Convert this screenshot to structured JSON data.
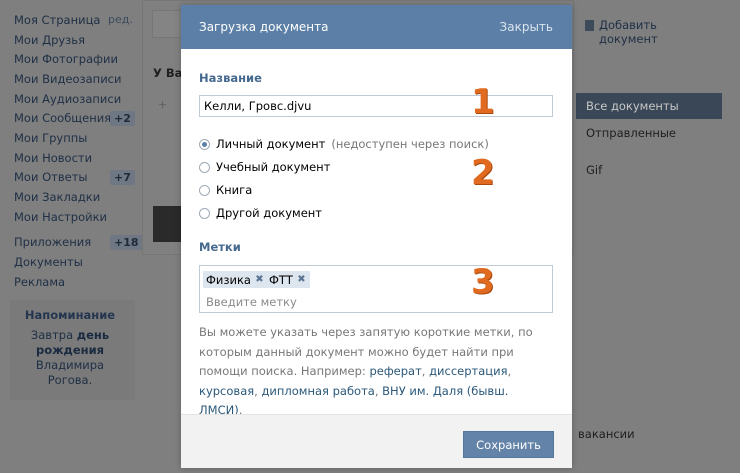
{
  "background": {
    "nav": [
      {
        "label": "Моя Страница",
        "extra": "ред."
      },
      {
        "label": "Мои Друзья"
      },
      {
        "label": "Мои Фотографии"
      },
      {
        "label": "Мои Видеозаписи"
      },
      {
        "label": "Мои Аудиозаписи"
      },
      {
        "label": "Мои Сообщения",
        "badge": "+2"
      },
      {
        "label": "Мои Группы"
      },
      {
        "label": "Мои Новости"
      },
      {
        "label": "Мои Ответы",
        "badge": "+7"
      },
      {
        "label": "Мои Закладки"
      },
      {
        "label": "Мои Настройки"
      },
      {
        "label": "Приложения",
        "badge": "+18"
      },
      {
        "label": "Документы"
      },
      {
        "label": "Реклама"
      }
    ],
    "reminder": {
      "title": "Напоминание",
      "line1_prefix": "Завтра ",
      "line1_bold": "день",
      "line2_bold": "рождения",
      "line3": "Владимира",
      "line4": "Рогова."
    },
    "center_heading": "У Ва",
    "center_plus": "+",
    "add_document": {
      "line1": "Добавить",
      "line2": "документ"
    },
    "right_tabs": [
      "Все документы",
      "Отправленные",
      "Gif"
    ],
    "vacancies": "вакансии"
  },
  "modal": {
    "title": "Загрузка документа",
    "close_label": "Закрыть",
    "name_label": "Название",
    "name_value": "Келли, Гровс.djvu",
    "radios": [
      {
        "label": "Личный документ",
        "note": "(недоступен через поиск)",
        "checked": true
      },
      {
        "label": "Учебный документ",
        "note": "",
        "checked": false
      },
      {
        "label": "Книга",
        "note": "",
        "checked": false
      },
      {
        "label": "Другой документ",
        "note": "",
        "checked": false
      }
    ],
    "tags_label": "Метки",
    "tags": [
      "Физика",
      "ФТТ"
    ],
    "tags_placeholder": "Введите метку",
    "hint": {
      "text_before": "Вы можете указать через запятую короткие метки, по которым данный документ можно будет найти при помощи поиска. Например: ",
      "examples": [
        "реферат",
        "диссертация",
        "курсовая",
        "дипломная работа",
        "ВНУ им. Даля (бывш. ЛМСИ)"
      ],
      "text_after": "."
    },
    "save_label": "Сохранить"
  },
  "annotations": [
    "1",
    "2",
    "3"
  ],
  "colors": {
    "header_bg": "#5b7fa6",
    "accent_text": "#45688e",
    "button_bg": "#6383a8",
    "annotation": "#e06a20"
  }
}
